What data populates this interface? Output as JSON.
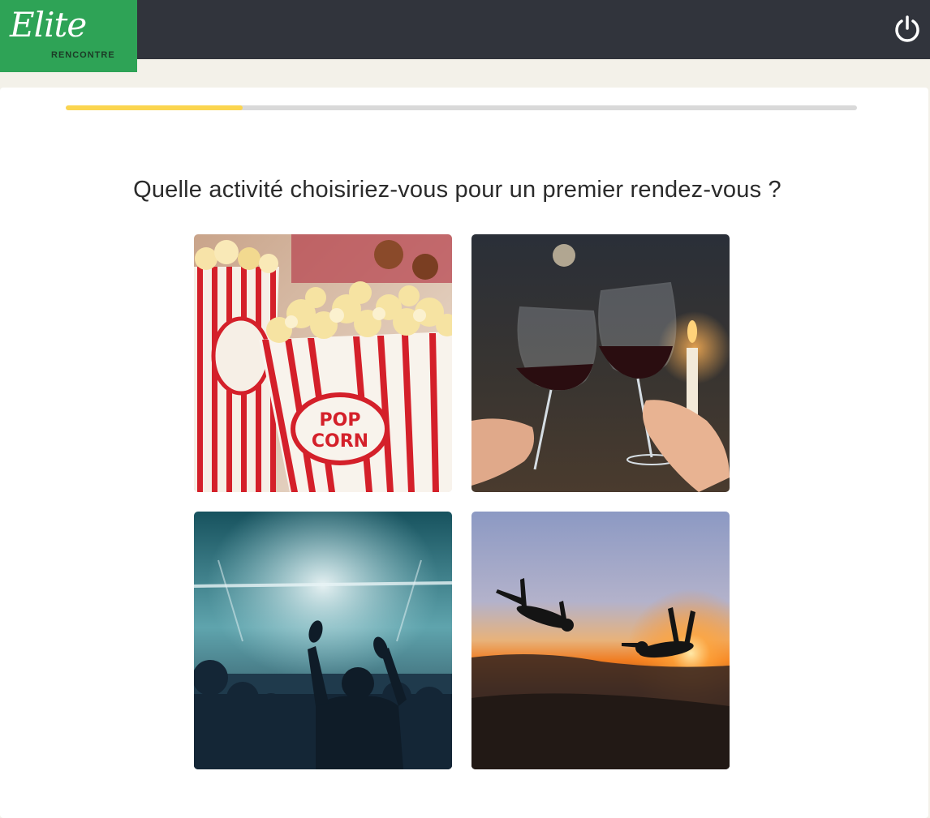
{
  "header": {
    "logo_script": "Elite",
    "logo_subtitle": "RENCONTRE",
    "power_icon": "power-icon"
  },
  "progress": {
    "value_percent": 22.4
  },
  "question": {
    "text": "Quelle activité choisiriez-vous pour un premier rendez-vous ?"
  },
  "options": [
    {
      "id": "popcorn",
      "image": "cinema-popcorn-image",
      "printed_text_a": "POP",
      "printed_text_b": "CORN"
    },
    {
      "id": "wine",
      "image": "wine-toast-image"
    },
    {
      "id": "concert",
      "image": "concert-crowd-image"
    },
    {
      "id": "skydive",
      "image": "skydiving-sunset-image"
    }
  ],
  "colors": {
    "header_bg": "#31343c",
    "logo_bg": "#2ea356",
    "progress_fill": "#fbd54f",
    "progress_track": "#d9d9d9",
    "page_bg": "#f3f1e9"
  }
}
